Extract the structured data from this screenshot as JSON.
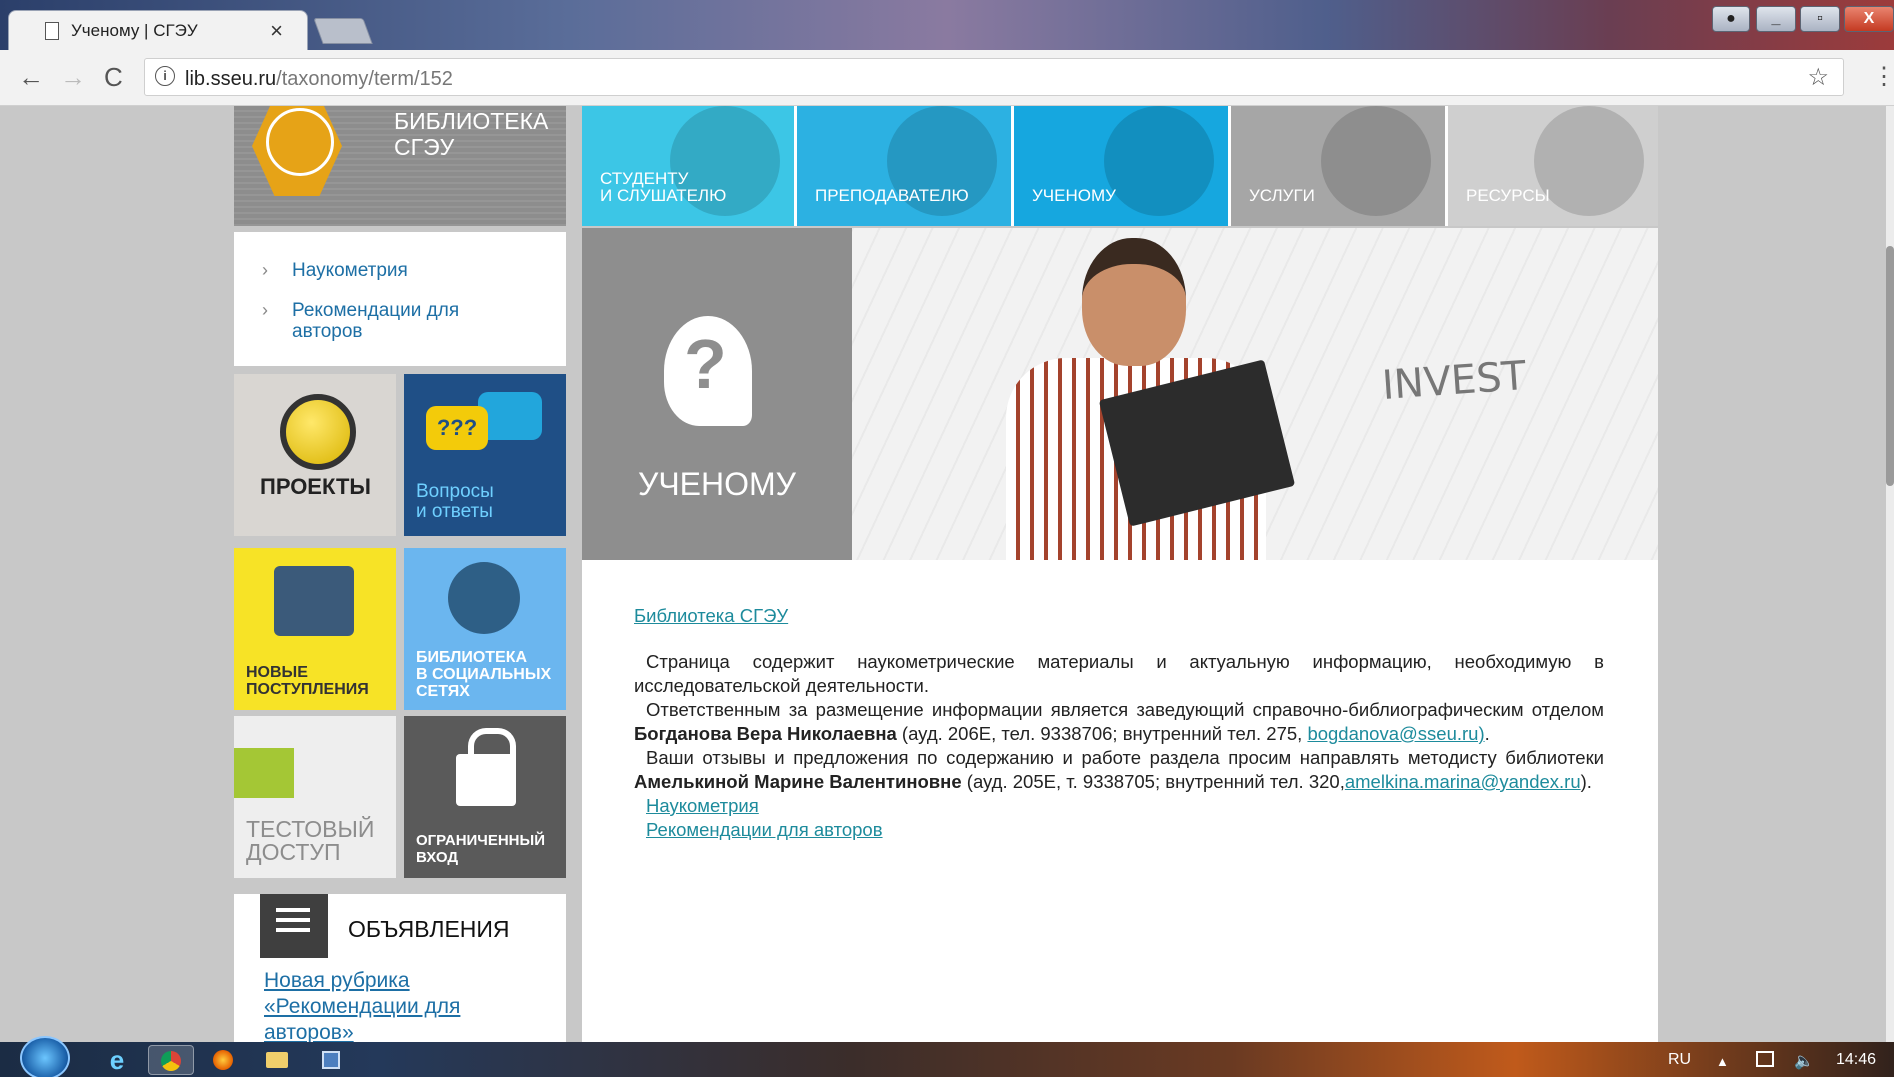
{
  "browser": {
    "tab_title": "Ученому | СГЭУ",
    "tab_close": "×",
    "url_host": "lib.sseu.ru",
    "url_path": "/taxonomy/term/152",
    "info_icon": "i",
    "star_icon": "☆",
    "back_icon": "←",
    "forward_icon": "→",
    "reload_icon": "C",
    "menu_icon": "⋮"
  },
  "logo": {
    "line1": "БИБЛИОТЕКА",
    "line2": "СГЭУ"
  },
  "topnav": {
    "items": [
      {
        "label1": "СТУДЕНТУ",
        "label2": "И СЛУШАТЕЛЮ"
      },
      {
        "label1": "ПРЕПОДАВАТЕЛЮ",
        "label2": ""
      },
      {
        "label1": "УЧЕНОМУ",
        "label2": ""
      },
      {
        "label1": "УСЛУГИ",
        "label2": ""
      },
      {
        "label1": "РЕСУРСЫ",
        "label2": ""
      }
    ]
  },
  "submenu": {
    "items": [
      {
        "label": "Наукометрия"
      },
      {
        "label": "Рекомендации для авторов"
      }
    ],
    "chevron": "›"
  },
  "tiles": {
    "projects": "ПРОЕКТЫ",
    "qa_line1": "Вопросы",
    "qa_line2": "и ответы",
    "qa_bubble": "???",
    "new_line1": "НОВЫЕ",
    "new_line2": "ПОСТУПЛЕНИЯ",
    "social_line1": "БИБЛИОТЕКА",
    "social_line2": "В СОЦИАЛЬНЫХ",
    "social_line3": "СЕТЯХ",
    "test_line1": "ТЕСТОВЫЙ",
    "test_line2": "ДОСТУП",
    "restricted_line1": "ОГРАНИЧЕННЫЙ",
    "restricted_line2": "ВХОД"
  },
  "announcements": {
    "title": "ОБЪЯВЛЕНИЯ",
    "link": "Новая рубрика «Рекомендации для авторов»"
  },
  "hero": {
    "title": "УЧЕНОМУ",
    "head_glyph": "?",
    "board_text": "INVEST"
  },
  "content": {
    "breadcrumb": "Библиотека СГЭУ",
    "p1": "Страница содержит наукометрические материалы и актуальную информацию, необходимую в исследовательской деятельности.",
    "p2_a": "Ответственным за размещение информации является заведующий справочно-библиографическим отделом ",
    "p2_name": "Богданова Вера Николаевна",
    "p2_b": " (ауд. 206Е, тел. 9338706; внутренний тел. 275, ",
    "p2_email": "bogdanova@sseu.ru)",
    "p2_c": ".",
    "p3_a": "Ваши отзывы и предложения по содержанию и работе раздела просим направлять методисту библиотеки ",
    "p3_name": "Амелькиной Марине Валентиновне",
    "p3_b": " (ауд. 205Е, т. 9338705; внутренний тел. 320,",
    "p3_email": "amelkina.marina@yandex.ru",
    "p3_c": ").",
    "link1": "Наукометрия",
    "link2": "Рекомендации для авторов"
  },
  "taskbar": {
    "lang": "RU",
    "time": "14:46",
    "up_arrow": "▲",
    "volume": "🔈"
  }
}
